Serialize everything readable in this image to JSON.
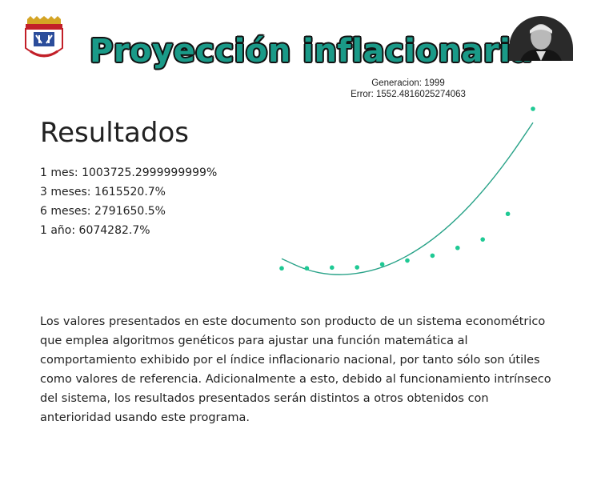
{
  "header": {
    "title": "Proyección inflacionaria"
  },
  "results": {
    "heading": "Resultados",
    "items": [
      "1 mes: 1003725.2999999999%",
      "3 meses: 1615520.7%",
      "6 meses: 2791650.5%",
      "1 año: 6074282.7%"
    ]
  },
  "chart_data": {
    "type": "scatter",
    "generation_label": "Generacion: 1999",
    "error_label": "Error: 1552.4816025274063",
    "x": [
      1,
      2,
      3,
      4,
      5,
      6,
      7,
      8,
      9,
      10,
      11
    ],
    "values": [
      0.0,
      0.0,
      0.3,
      0.4,
      1.7,
      3.3,
      5.4,
      8.7,
      12.3,
      23.2,
      68.0
    ],
    "fit": {
      "x": [
        1,
        2,
        3,
        4,
        5,
        6,
        7,
        8,
        9,
        10,
        11
      ],
      "y": [
        4.1,
        -0.9,
        -2.9,
        -2.4,
        0.2,
        5.1,
        12.1,
        21.3,
        32.7,
        46.3,
        62.1
      ]
    },
    "xlim": [
      1,
      11
    ],
    "ylim": [
      -3,
      68
    ],
    "grid": false,
    "colors": {
      "points": "#1fc994",
      "fit": "#2aa389"
    }
  },
  "disclaimer": "Los valores presentados en este documento son producto de un sistema econométrico que emplea algoritmos genéticos para ajustar una función matemática al comportamiento exhibido por el índice inflacionario nacional, por tanto sólo son útiles como valores de referencia. Adicionalmente a esto, debido al funcionamiento intrínseco del sistema, los resultados presentados serán distintos a otros obtenidos con anterioridad usando este programa."
}
